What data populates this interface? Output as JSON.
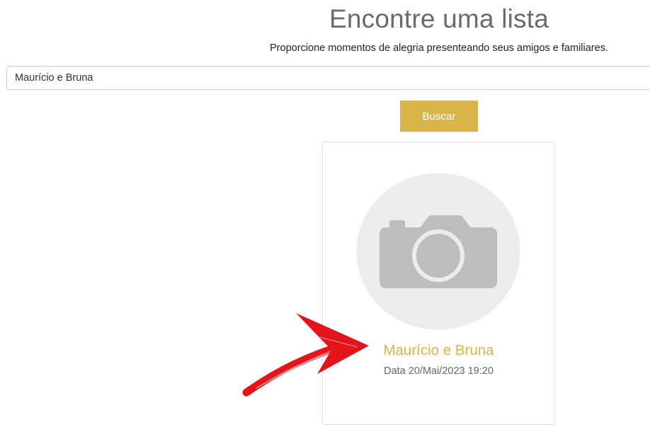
{
  "header": {
    "title": "Encontre uma lista",
    "subtitle": "Proporcione momentos de alegria presenteando seus amigos e familiares."
  },
  "search": {
    "value": "Maurício e Bruna",
    "button_label": "Buscar"
  },
  "results": [
    {
      "name": "Maurício e Bruna",
      "date": "Data 20/Mai/2023 19:20",
      "image_icon": "camera-icon"
    }
  ],
  "colors": {
    "accent": "#d9b44a",
    "title": "#6b6b6b",
    "annotation_arrow": "#e3141b"
  },
  "icons": {
    "placeholder": "camera-icon",
    "annotation": "red-arrow-icon"
  }
}
